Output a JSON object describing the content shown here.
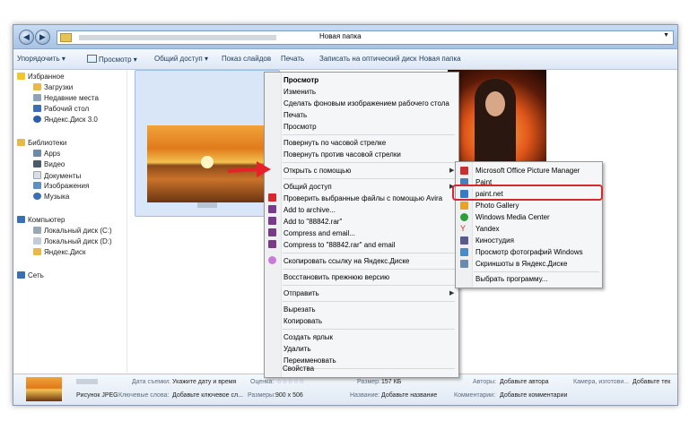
{
  "address": {
    "path": "Новая папка"
  },
  "toolbar": {
    "items": [
      "Упорядочить ▾",
      "Просмотр ▾",
      "Общий доступ ▾",
      "Показ слайдов",
      "Печать",
      "Записать на оптический диск",
      "Новая папка"
    ]
  },
  "sidebar": {
    "favorites": "Избранное",
    "fav_items": [
      "Загрузки",
      "Недавние места",
      "Рабочий стол",
      "Яндекс.Диск 3.0"
    ],
    "libraries": "Библиотеки",
    "lib_items": [
      "Apps",
      "Видео",
      "Документы",
      "Изображения",
      "Музыка"
    ],
    "computer": "Компьютер",
    "comp_items": [
      "Локальный диск (C:)",
      "Локальный диск (D:)",
      "Яндекс.Диск"
    ],
    "network": "Сеть"
  },
  "context_menu": {
    "items": [
      "Просмотр",
      "Изменить",
      "Сделать фоновым изображением рабочего стола",
      "Печать",
      "Просмотр",
      "Повернуть по часовой стрелке",
      "Повернуть против часовой стрелки",
      "Открыть с помощью",
      "Общий доступ",
      "Проверить выбранные файлы с помощью Avira",
      "Add to archive...",
      "Add to \"88842.rar\"",
      "Compress and email...",
      "Compress to \"88842.rar\" and email",
      "Скопировать ссылку на Яндекс.Диске",
      "Восстановить прежнюю версию",
      "Отправить",
      "Вырезать",
      "Копировать",
      "Создать ярлык",
      "Удалить",
      "Переименовать",
      "Свойства"
    ]
  },
  "submenu": {
    "items": [
      "Microsoft Office Picture Manager",
      "Paint",
      "paint.net",
      "Photo Gallery",
      "Windows Media Center",
      "Yandex",
      "Киностудия",
      "Просмотр фотографий Windows",
      "Скриншоты в Яндекс.Диске",
      "Выбрать программу..."
    ]
  },
  "details": {
    "type": "Рисунок JPEG",
    "date_label": "Дата съемки:",
    "date_value": "Укажите дату и время",
    "rating_label": "Оценка:",
    "rating_value": "☆☆☆☆☆",
    "tags_label": "Ключевые слова:",
    "tags_value": "Добавьте ключевое сл...",
    "dims_label": "Размеры:",
    "dims_value": "900 x 506",
    "size_label": "Размер:",
    "size_value": "157 КБ",
    "title_label": "Название:",
    "title_value": "Добавьте название",
    "authors_label": "Авторы:",
    "authors_value": "Добавьте автора",
    "comments_label": "Комментарии:",
    "comments_value": "Добавьте комментарии",
    "camera_label": "Камера, изготови...",
    "camera_value": "Добавьте тек"
  },
  "colors": {
    "highlight": "#d6282e",
    "arrow": "#e8202a",
    "selection": "#d8e6f8"
  }
}
